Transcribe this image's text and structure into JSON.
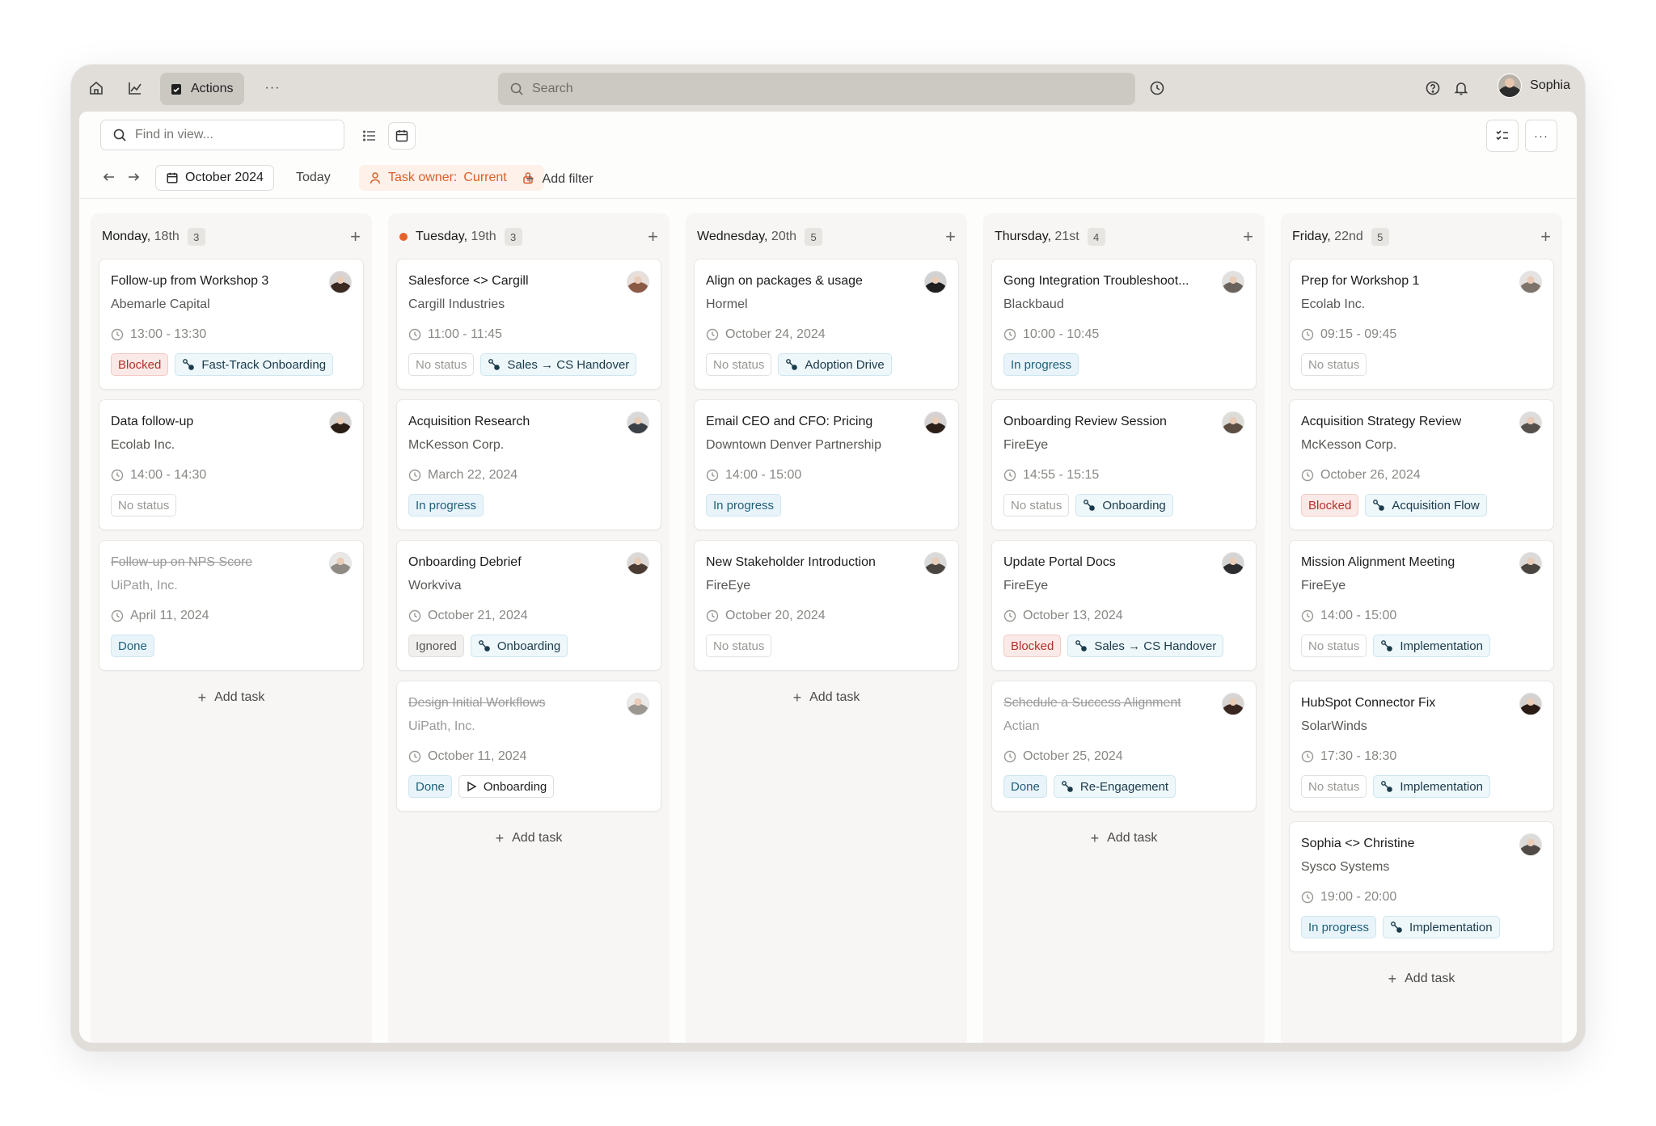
{
  "topbar": {
    "actions_label": "Actions",
    "more": "···",
    "search_placeholder": "Search",
    "user_name": "Sophia"
  },
  "toolbar": {
    "find_placeholder": "Find in view...",
    "month_label": "October 2024",
    "today_label": "Today",
    "filter_key": "Task owner:",
    "filter_value": "Current",
    "add_filter_label": "Add filter",
    "more": "···"
  },
  "add_task_label": "Add task",
  "colors": {
    "accent_orange": "#e4622a",
    "blocked": "#b1322a",
    "progress": "#1f5f7a"
  },
  "columns": [
    {
      "day": "Monday,",
      "date": "18th",
      "count": "3",
      "today": false,
      "cards": [
        {
          "title": "Follow-up from Workshop 3",
          "company": "Abemarle Capital",
          "time": "13:00 - 13:30",
          "done": false,
          "av": "#3a2a22",
          "tags": [
            {
              "label": "Blocked",
              "kind": "blocked"
            },
            {
              "label": "Fast-Track Onboarding",
              "kind": "flow",
              "icon": "flow"
            }
          ]
        },
        {
          "title": "Data follow-up",
          "company": "Ecolab Inc.",
          "time": "14:00 - 14:30",
          "done": false,
          "av": "#2a1d16",
          "tags": [
            {
              "label": "No status",
              "kind": "nostatus"
            }
          ]
        },
        {
          "title": "Follow-up on NPS Score",
          "company": "UiPath, Inc.",
          "time": "April 11, 2024",
          "done": true,
          "av": "#8f8a84",
          "tags": [
            {
              "label": "Done",
              "kind": "done"
            }
          ]
        }
      ]
    },
    {
      "day": "Tuesday,",
      "date": "19th",
      "count": "3",
      "today": true,
      "cards": [
        {
          "title": "Salesforce <> Cargill",
          "company": "Cargill Industries",
          "time": "11:00 - 11:45",
          "done": false,
          "av": "#8a5a44",
          "tags": [
            {
              "label": "No status",
              "kind": "nostatus"
            },
            {
              "label": "Sales → CS Handover",
              "kind": "flow",
              "icon": "flow"
            }
          ]
        },
        {
          "title": "Acquisition Research",
          "company": "McKesson Corp.",
          "time": "March 22, 2024",
          "done": false,
          "av": "#3b4046",
          "tags": [
            {
              "label": "In progress",
              "kind": "progress"
            }
          ]
        },
        {
          "title": "Onboarding Debrief",
          "company": "Workviva",
          "time": "October 21, 2024",
          "done": false,
          "av": "#4a3b33",
          "tags": [
            {
              "label": "Ignored",
              "kind": "ignored"
            },
            {
              "label": "Onboarding",
              "kind": "flow",
              "icon": "flow"
            }
          ]
        },
        {
          "title": "Design Initial Workflows",
          "company": "UiPath, Inc.",
          "time": "October 11, 2024",
          "done": true,
          "av": "#9c9690",
          "tags": [
            {
              "label": "Done",
              "kind": "done"
            },
            {
              "label": "Onboarding",
              "kind": "plain",
              "icon": "play"
            }
          ]
        }
      ]
    },
    {
      "day": "Wednesday,",
      "date": "20th",
      "count": "5",
      "today": false,
      "cards": [
        {
          "title": "Align on packages & usage",
          "company": "Hormel",
          "time": "October 24, 2024",
          "done": false,
          "av": "#1f1f1f",
          "tags": [
            {
              "label": "No status",
              "kind": "nostatus"
            },
            {
              "label": "Adoption Drive",
              "kind": "flow",
              "icon": "flow"
            }
          ]
        },
        {
          "title": "Email CEO and CFO: Pricing",
          "company": "Downtown Denver Partnership",
          "time": "14:00 - 15:00",
          "done": false,
          "av": "#2b1f19",
          "tags": [
            {
              "label": "In progress",
              "kind": "progress"
            }
          ]
        },
        {
          "title": "New Stakeholder Introduction",
          "company": "FireEye",
          "time": "October 20, 2024",
          "done": false,
          "av": "#4b4541",
          "tags": [
            {
              "label": "No status",
              "kind": "nostatus"
            }
          ]
        }
      ]
    },
    {
      "day": "Thursday,",
      "date": "21st",
      "count": "4",
      "today": false,
      "cards": [
        {
          "title": "Gong Integration Troubleshoot...",
          "company": "Blackbaud",
          "time": "10:00 - 10:45",
          "done": false,
          "av": "#6a625c",
          "tags": [
            {
              "label": "In progress",
              "kind": "progress"
            }
          ]
        },
        {
          "title": "Onboarding Review Session",
          "company": "FireEye",
          "time": "14:55 - 15:15",
          "done": false,
          "av": "#5c4e42",
          "tags": [
            {
              "label": "No status",
              "kind": "nostatus"
            },
            {
              "label": "Onboarding",
              "kind": "flow",
              "icon": "flow"
            }
          ]
        },
        {
          "title": "Update Portal Docs",
          "company": "FireEye",
          "time": "October 13, 2024",
          "done": false,
          "av": "#2d2d30",
          "tags": [
            {
              "label": "Blocked",
              "kind": "blocked"
            },
            {
              "label": "Sales → CS Handover",
              "kind": "flow",
              "icon": "flow"
            }
          ]
        },
        {
          "title": "Schedule a Success Alignment",
          "company": "Actian",
          "time": "October 25, 2024",
          "done": true,
          "av": "#3a2620",
          "tags": [
            {
              "label": "Done",
              "kind": "done"
            },
            {
              "label": "Re-Engagement",
              "kind": "flow",
              "icon": "flow"
            }
          ]
        }
      ]
    },
    {
      "day": "Friday,",
      "date": "22nd",
      "count": "5",
      "today": false,
      "cards": [
        {
          "title": "Prep for Workshop 1",
          "company": "Ecolab Inc.",
          "time": "09:15 - 09:45",
          "done": false,
          "av": "#7d736b",
          "tags": [
            {
              "label": "No status",
              "kind": "nostatus"
            }
          ]
        },
        {
          "title": "Acquisition Strategy Review",
          "company": "McKesson Corp.",
          "time": "October 26, 2024",
          "done": false,
          "av": "#55504c",
          "tags": [
            {
              "label": "Blocked",
              "kind": "blocked"
            },
            {
              "label": "Acquisition Flow",
              "kind": "flow",
              "icon": "flow"
            }
          ]
        },
        {
          "title": "Mission Alignment Meeting",
          "company": "FireEye",
          "time": "14:00 - 15:00",
          "done": false,
          "av": "#4a4541",
          "tags": [
            {
              "label": "No status",
              "kind": "nostatus"
            },
            {
              "label": "Implementation",
              "kind": "flow",
              "icon": "flow"
            }
          ]
        },
        {
          "title": "HubSpot Connector Fix",
          "company": "SolarWinds",
          "time": "17:30 - 18:30",
          "done": false,
          "av": "#2a1c15",
          "tags": [
            {
              "label": "No status",
              "kind": "nostatus"
            },
            {
              "label": "Implementation",
              "kind": "flow",
              "icon": "flow"
            }
          ]
        },
        {
          "title": "Sophia <> Christine",
          "company": "Sysco Systems",
          "time": "19:00 - 20:00",
          "done": false,
          "av": "#504a46",
          "tags": [
            {
              "label": "In progress",
              "kind": "progress"
            },
            {
              "label": "Implementation",
              "kind": "flow",
              "icon": "flow"
            }
          ]
        }
      ]
    }
  ]
}
